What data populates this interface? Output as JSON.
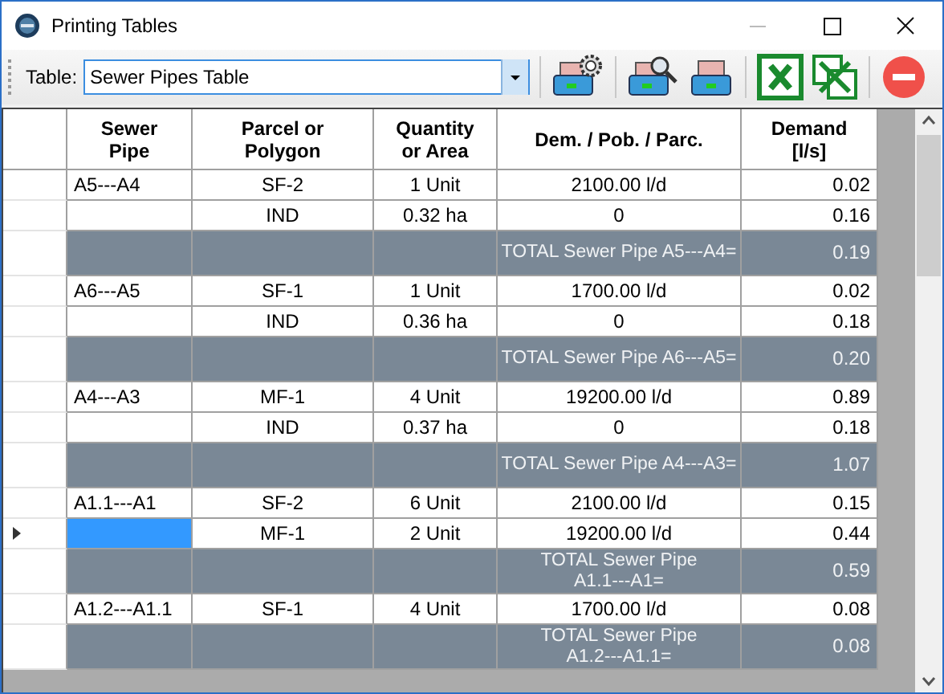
{
  "window": {
    "title": "Printing Tables"
  },
  "toolbar": {
    "table_label": "Table:",
    "table_select": "Sewer Pipes Table"
  },
  "grid": {
    "columns": [
      "Sewer\nPipe",
      "Parcel or\nPolygon",
      "Quantity\nor Area",
      "Dem. / Pob. / Parc.",
      "Demand\n[l/s]"
    ],
    "rows": [
      {
        "kind": "data",
        "selected": false,
        "cells": [
          "A5---A4",
          "SF-2",
          "1 Unit",
          "2100.00 l/d",
          "0.02"
        ]
      },
      {
        "kind": "data",
        "selected": false,
        "cells": [
          "",
          "IND",
          "0.32 ha",
          "0",
          "0.16"
        ]
      },
      {
        "kind": "total",
        "selected": false,
        "label": "TOTAL Sewer Pipe A5---A4=",
        "value": "0.19"
      },
      {
        "kind": "data",
        "selected": false,
        "cells": [
          "A6---A5",
          "SF-1",
          "1 Unit",
          "1700.00 l/d",
          "0.02"
        ]
      },
      {
        "kind": "data",
        "selected": false,
        "cells": [
          "",
          "IND",
          "0.36 ha",
          "0",
          "0.18"
        ]
      },
      {
        "kind": "total",
        "selected": false,
        "label": "TOTAL Sewer Pipe A6---A5=",
        "value": "0.20"
      },
      {
        "kind": "data",
        "selected": false,
        "cells": [
          "A4---A3",
          "MF-1",
          "4 Unit",
          "19200.00 l/d",
          "0.89"
        ]
      },
      {
        "kind": "data",
        "selected": false,
        "cells": [
          "",
          "IND",
          "0.37 ha",
          "0",
          "0.18"
        ]
      },
      {
        "kind": "total",
        "selected": false,
        "label": "TOTAL Sewer Pipe A4---A3=",
        "value": "1.07"
      },
      {
        "kind": "data",
        "selected": false,
        "cells": [
          "A1.1---A1",
          "SF-2",
          "6 Unit",
          "2100.00 l/d",
          "0.15"
        ]
      },
      {
        "kind": "data",
        "selected": true,
        "cells": [
          "",
          "MF-1",
          "2 Unit",
          "19200.00 l/d",
          "0.44"
        ]
      },
      {
        "kind": "total",
        "selected": false,
        "label": "TOTAL Sewer Pipe\nA1.1---A1=",
        "value": "0.59"
      },
      {
        "kind": "data",
        "selected": false,
        "cells": [
          "A1.2---A1.1",
          "SF-1",
          "4 Unit",
          "1700.00 l/d",
          "0.08"
        ]
      },
      {
        "kind": "total",
        "selected": false,
        "label": "TOTAL Sewer Pipe\nA1.2---A1.1=",
        "value": "0.08"
      }
    ]
  }
}
